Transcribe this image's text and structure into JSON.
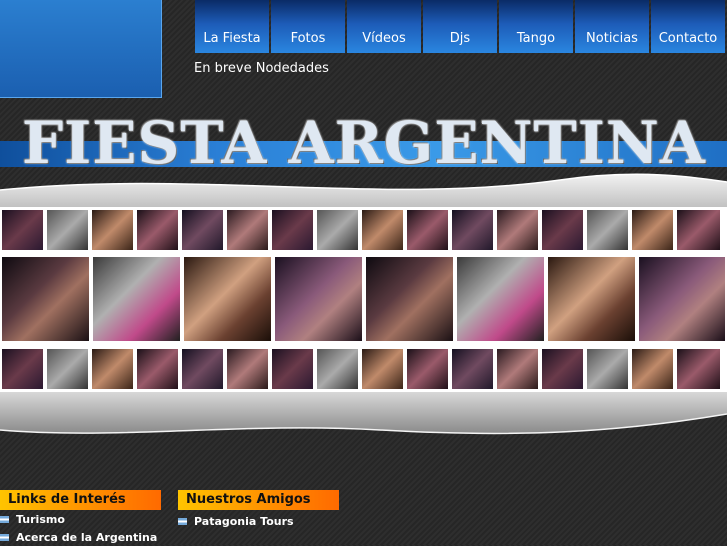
{
  "nav": {
    "items": [
      "La Fiesta",
      "Fotos",
      "Vídeos",
      "Djs",
      "Tango",
      "Noticias",
      "Contacto"
    ]
  },
  "subnav": {
    "text": "En breve Nodedades"
  },
  "banner": {
    "title": "FIESTA ARGENTINA"
  },
  "links_panel": {
    "heading": "Links de Interés",
    "items": [
      "Turismo",
      "Acerca de la Argentina"
    ]
  },
  "friends_panel": {
    "heading": "Nuestros Amigos",
    "items": [
      "Patagonia Tours"
    ]
  },
  "colors": {
    "nav_blue": "#1d5cb8",
    "panel_orange": "#ff8c00",
    "flag_blue": "#75aadb"
  }
}
